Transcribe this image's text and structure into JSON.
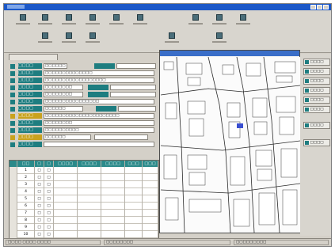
{
  "toolbar": {
    "buttons": [
      {
        "name": "toolbar-button-1",
        "icon": "document-icon"
      },
      {
        "name": "toolbar-button-2",
        "icon": "folder-icon"
      },
      {
        "name": "toolbar-button-3",
        "icon": "save-icon"
      },
      {
        "name": "toolbar-button-4",
        "icon": "print-icon"
      },
      {
        "name": "toolbar-button-5",
        "icon": "search-icon"
      },
      {
        "name": "toolbar-button-6",
        "icon": "map-icon"
      },
      {
        "name": "toolbar-button-7",
        "icon": "list-icon"
      },
      {
        "name": "toolbar-button-8",
        "icon": "settings-icon"
      },
      {
        "name": "toolbar-button-9",
        "icon": "user-icon"
      },
      {
        "name": "toolbar-button-10",
        "icon": "help-icon"
      },
      {
        "name": "toolbar-button-11",
        "icon": "table-icon"
      },
      {
        "name": "toolbar-button-12",
        "icon": "layer-icon"
      },
      {
        "name": "toolbar-button-13",
        "icon": "zoom-icon"
      },
      {
        "name": "toolbar-button-14",
        "icon": "export-icon"
      }
    ]
  },
  "form": {
    "rows": [
      {
        "label": "□□□□",
        "value": "□□□□□□",
        "color": "teal"
      },
      {
        "label": "□□□□",
        "value": "□□□□□□□□□□□□□□",
        "color": "teal"
      },
      {
        "label": "□□□□",
        "value": "□□□□□□□□□□□□□□□□□□",
        "color": "teal"
      },
      {
        "label": "□□□□",
        "value": "□□□□□□□□",
        "color": "teal"
      },
      {
        "label": "□□□□",
        "value": "□□□□□□□□",
        "color": "teal"
      },
      {
        "label": "□□□□",
        "value": "□□□□□□□□□□□□□□□□",
        "color": "teal"
      },
      {
        "label": "□□□□",
        "value": "□□□□□□",
        "color": "teal"
      },
      {
        "label": "□□□□",
        "value": "□□□□□□□□□□□□□□□□□□□□□□",
        "color": "yellow"
      },
      {
        "label": "□□□□",
        "value": "□□□□□□□□",
        "color": "teal"
      },
      {
        "label": "□□□□",
        "value": "□□□□□□□□□□",
        "color": "teal"
      },
      {
        "label": "□□□□",
        "value": "□□□□□□",
        "color": "yellow"
      },
      {
        "label": "□□□□",
        "value": "",
        "color": "teal"
      }
    ]
  },
  "grid": {
    "columns": [
      "□□",
      "□",
      "□",
      "□□□□",
      "□□□□",
      "□□□□",
      "□□□",
      "□□□"
    ],
    "rows": [
      [
        "1",
        "□",
        "□",
        "",
        "",
        "",
        "",
        ""
      ],
      [
        "2",
        "□",
        "□",
        "",
        "",
        "",
        "",
        ""
      ],
      [
        "3",
        "□",
        "□",
        "",
        "",
        "",
        "",
        ""
      ],
      [
        "4",
        "□",
        "□",
        "",
        "",
        "",
        "",
        ""
      ],
      [
        "5",
        "□",
        "□",
        "",
        "",
        "",
        "",
        ""
      ],
      [
        "6",
        "□",
        "□",
        "",
        "",
        "",
        "",
        ""
      ],
      [
        "7",
        "□",
        "□",
        "",
        "",
        "",
        "",
        ""
      ],
      [
        "8",
        "□",
        "□",
        "",
        "",
        "",
        "",
        ""
      ],
      [
        "9",
        "□",
        "□",
        "",
        "",
        "",
        "",
        ""
      ],
      [
        "10",
        "□",
        "□",
        "",
        "",
        "",
        "",
        ""
      ]
    ]
  },
  "map_panel": {
    "buttons": [
      "□□□□",
      "□□□□",
      "□□□□",
      "□□□□",
      "□□□□",
      "□□□□",
      "□□□□",
      "□□□□"
    ]
  },
  "status": {
    "left": "□□□□  □□□□  □□□□",
    "center": "□□□□□□□□",
    "right": "□□□□□□□□□"
  },
  "colors": {
    "accent_teal": "#1e7d80",
    "accent_yellow": "#c9a21e",
    "titlebar": "#1c58c8"
  }
}
